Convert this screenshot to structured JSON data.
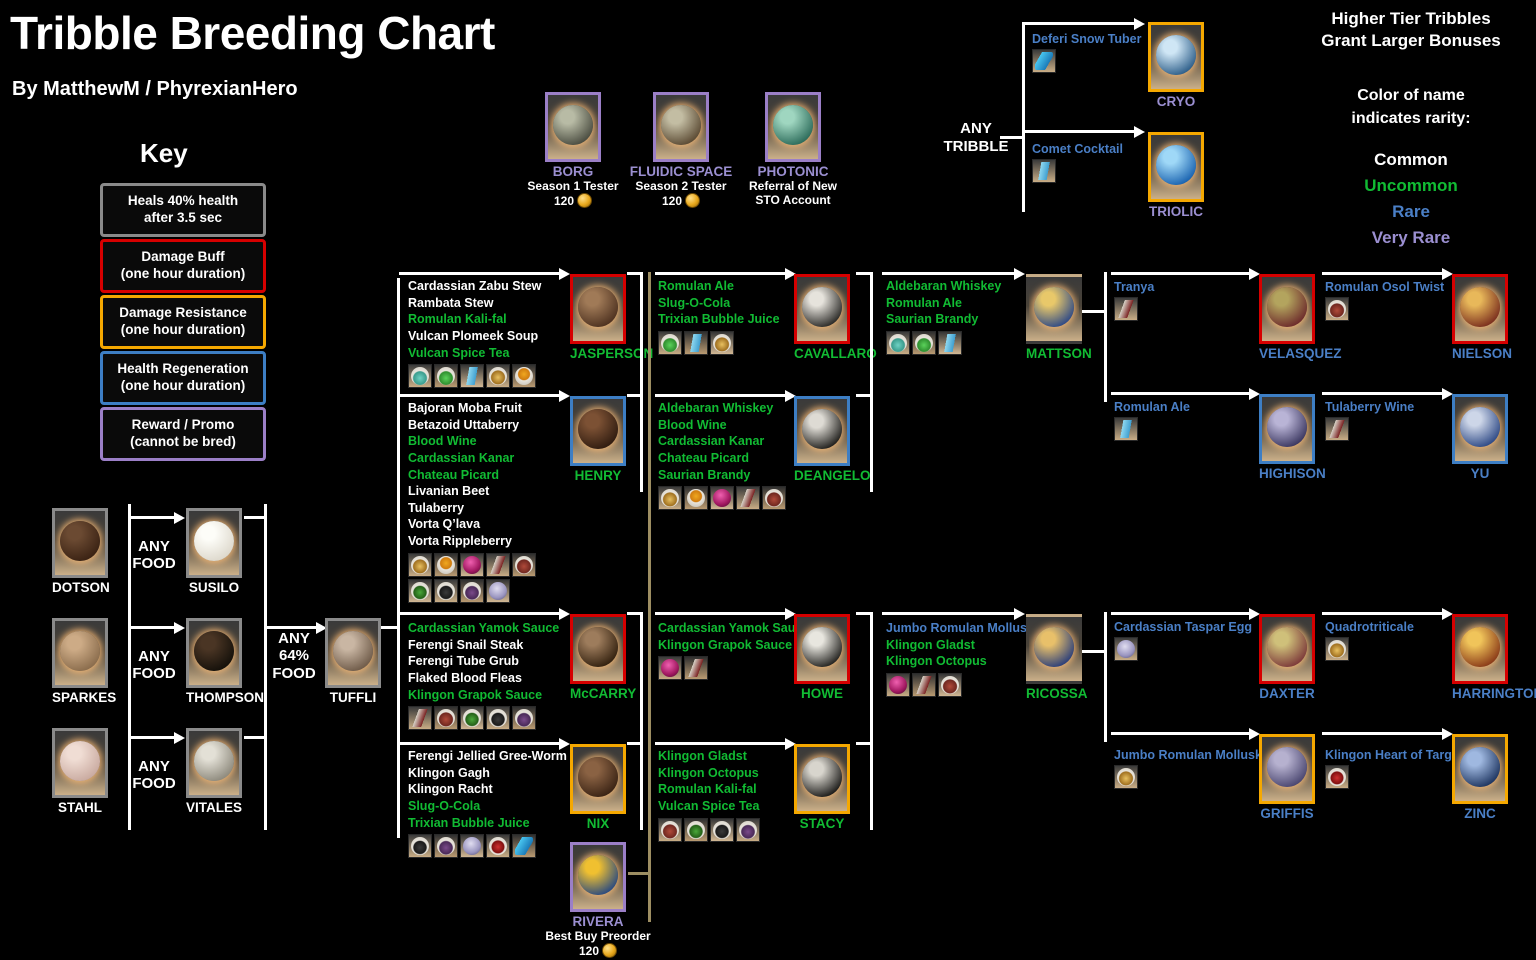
{
  "header": {
    "title": "Tribble Breeding Chart",
    "byline": "By MatthewM / PhyrexianHero",
    "key_title": "Key"
  },
  "key": {
    "items": [
      {
        "text": "Heals 40% health\nafter 3.5 sec",
        "color": "#8a8a8a",
        "name": "heal"
      },
      {
        "text": "Damage Buff\n(one hour duration)",
        "color": "#d60000",
        "name": "damage-buff"
      },
      {
        "text": "Damage Resistance\n(one hour duration)",
        "color": "#f5a800",
        "name": "damage-resistance"
      },
      {
        "text": "Health Regeneration\n(one hour duration)",
        "color": "#3d7ec4",
        "name": "health-regen"
      },
      {
        "text": "Reward / Promo\n(cannot be bred)",
        "color": "#9b7fc7",
        "name": "reward-promo"
      }
    ]
  },
  "notes": {
    "higher_tier": "Higher Tier Tribbles\nGrant Larger Bonuses",
    "color_rarity": "Color of name\nindicates rarity:",
    "rarities": [
      {
        "label": "Common",
        "color": "#ffffff"
      },
      {
        "label": "Uncommon",
        "color": "#11bb33"
      },
      {
        "label": "Rare",
        "color": "#4a7fc6"
      },
      {
        "label": "Very Rare",
        "color": "#9b8fd1"
      }
    ]
  },
  "promos": {
    "items": [
      {
        "name": "BORG",
        "sub": "Season 1 Tester",
        "cost": "120",
        "rarity": "vrare",
        "border": "purple"
      },
      {
        "name": "FLUIDIC SPACE",
        "sub": "Season 2 Tester",
        "cost": "120",
        "rarity": "vrare",
        "border": "purple"
      },
      {
        "name": "PHOTONIC",
        "sub": "Referral of New\nSTO Account",
        "cost": "",
        "rarity": "vrare",
        "border": "purple"
      }
    ]
  },
  "any_tribble": {
    "label": "ANY\nTRIBBLE",
    "branches": [
      {
        "food": "Deferi Snow Tuber",
        "food_rarity": "vrare",
        "result": "CRYO",
        "rarity": "vrare",
        "border": "orange"
      },
      {
        "food": "Comet Cocktail",
        "food_rarity": "vrare",
        "result": "TRIOLIC",
        "rarity": "vrare",
        "border": "orange"
      }
    ]
  },
  "base": {
    "any_food_label": "ANY\nFOOD",
    "any_64_label": "ANY\n64%\nFOOD",
    "pairs": [
      {
        "from": "DOTSON",
        "to": "SUSILO"
      },
      {
        "from": "SPARKES",
        "to": "THOMPSON"
      },
      {
        "from": "STAHL",
        "to": "VITALES"
      }
    ],
    "tuffli": "TUFFLI"
  },
  "stage2": [
    {
      "result": "JASPERSON",
      "rarity": "uncommon",
      "border": "red",
      "foods": [
        {
          "label": "Cardassian Zabu  Stew",
          "rarity": "common"
        },
        {
          "label": "Rambata Stew",
          "rarity": "common"
        },
        {
          "label": "Romulan Kali-fal",
          "rarity": "uncommon"
        },
        {
          "label": "Vulcan Plomeek Soup",
          "rarity": "common"
        },
        {
          "label": "Vulcan Spice Tea",
          "rarity": "uncommon"
        }
      ]
    },
    {
      "result": "HENRY",
      "rarity": "uncommon",
      "border": "blue",
      "foods": [
        {
          "label": "Bajoran Moba Fruit",
          "rarity": "common"
        },
        {
          "label": "Betazoid Uttaberry",
          "rarity": "common"
        },
        {
          "label": "Blood Wine",
          "rarity": "uncommon"
        },
        {
          "label": "Cardassian Kanar",
          "rarity": "uncommon"
        },
        {
          "label": "Chateau Picard",
          "rarity": "uncommon"
        },
        {
          "label": "Livanian Beet",
          "rarity": "common"
        },
        {
          "label": "Tulaberry",
          "rarity": "common"
        },
        {
          "label": "Vorta Q’lava",
          "rarity": "common"
        },
        {
          "label": "Vorta Rippleberry",
          "rarity": "common"
        }
      ]
    },
    {
      "result": "McCARRY",
      "rarity": "uncommon",
      "border": "red",
      "foods": [
        {
          "label": "Cardassian Yamok Sauce",
          "rarity": "uncommon"
        },
        {
          "label": "Ferengi Snail  Steak",
          "rarity": "common"
        },
        {
          "label": "Ferengi Tube Grub",
          "rarity": "common"
        },
        {
          "label": "Flaked Blood Fleas",
          "rarity": "common"
        },
        {
          "label": "Klingon Grapok Sauce",
          "rarity": "uncommon"
        }
      ]
    },
    {
      "result": "NIX",
      "rarity": "uncommon",
      "border": "orange",
      "foods": [
        {
          "label": "Ferengi Jellied Gree-Worm",
          "rarity": "common"
        },
        {
          "label": "Klingon Gagh",
          "rarity": "common"
        },
        {
          "label": "Klingon Racht",
          "rarity": "common"
        },
        {
          "label": "Slug-O-Cola",
          "rarity": "uncommon"
        },
        {
          "label": "Trixian Bubble Juice",
          "rarity": "uncommon"
        }
      ]
    }
  ],
  "rivera": {
    "name": "RIVERA",
    "sub": "Best Buy Preorder",
    "cost": "120",
    "rarity": "vrare",
    "border": "purple"
  },
  "stage3": [
    {
      "result": "CAVALLARO",
      "rarity": "uncommon",
      "border": "red",
      "foods": [
        {
          "label": "Romulan Ale",
          "rarity": "uncommon"
        },
        {
          "label": "Slug-O-Cola",
          "rarity": "uncommon"
        },
        {
          "label": "Trixian Bubble Juice",
          "rarity": "uncommon"
        }
      ]
    },
    {
      "result": "DEANGELO",
      "rarity": "uncommon",
      "border": "blue",
      "foods": [
        {
          "label": "Aldebaran Whiskey",
          "rarity": "uncommon"
        },
        {
          "label": "Blood Wine",
          "rarity": "uncommon"
        },
        {
          "label": "Cardassian Kanar",
          "rarity": "uncommon"
        },
        {
          "label": "Chateau Picard",
          "rarity": "uncommon"
        },
        {
          "label": "Saurian Brandy",
          "rarity": "uncommon"
        }
      ]
    },
    {
      "result": "HOWE",
      "rarity": "uncommon",
      "border": "red",
      "foods": [
        {
          "label": "Cardassian Yamok Sauce",
          "rarity": "uncommon"
        },
        {
          "label": "Klingon Grapok Sauce",
          "rarity": "uncommon"
        }
      ]
    },
    {
      "result": "STACY",
      "rarity": "uncommon",
      "border": "orange",
      "foods": [
        {
          "label": "Klingon Gladst",
          "rarity": "uncommon"
        },
        {
          "label": "Klingon Octopus",
          "rarity": "uncommon"
        },
        {
          "label": "Romulan Kali-fal",
          "rarity": "uncommon"
        },
        {
          "label": "Vulcan Spice Tea",
          "rarity": "uncommon"
        }
      ]
    }
  ],
  "stage4": [
    {
      "result": "MATTSON",
      "rarity": "uncommon",
      "border": "grad-br",
      "foods": [
        {
          "label": "Aldebaran Whiskey",
          "rarity": "uncommon"
        },
        {
          "label": "Romulan Ale",
          "rarity": "uncommon"
        },
        {
          "label": "Saurian Brandy",
          "rarity": "uncommon"
        }
      ]
    },
    {
      "result": "RICOSSA",
      "rarity": "uncommon",
      "border": "grad-or",
      "foods": [
        {
          "label": "Jumbo Romulan Mollusk",
          "rarity": "rare"
        },
        {
          "label": "Klingon Gladst",
          "rarity": "uncommon"
        },
        {
          "label": "Klingon Octopus",
          "rarity": "uncommon"
        }
      ]
    }
  ],
  "stage5": [
    {
      "food": "Tranya",
      "food_rarity": "rare",
      "result": "VELASQUEZ",
      "rarity": "rare",
      "border": "red"
    },
    {
      "food": "Romulan Ale",
      "food_rarity": "rare",
      "result": "HIGHISON",
      "rarity": "rare",
      "border": "blue"
    },
    {
      "food": "Cardassian Taspar  Egg",
      "food_rarity": "rare",
      "result": "DAXTER",
      "rarity": "rare",
      "border": "red"
    },
    {
      "food": "Jumbo Romulan Mollusk",
      "food_rarity": "rare",
      "result": "GRIFFIS",
      "rarity": "rare",
      "border": "orange"
    }
  ],
  "stage6": [
    {
      "food": "Romulan Osol Twist",
      "food_rarity": "rare",
      "result": "NIELSON",
      "rarity": "rare",
      "border": "red"
    },
    {
      "food": "Tulaberry Wine",
      "food_rarity": "rare",
      "result": "YU",
      "rarity": "rare",
      "border": "blue"
    },
    {
      "food": "Quadrotriticale",
      "food_rarity": "rare",
      "result": "HARRINGTON",
      "rarity": "rare",
      "border": "red"
    },
    {
      "food": "Klingon Heart of Targ",
      "food_rarity": "rare",
      "result": "ZINC",
      "rarity": "rare",
      "border": "orange"
    }
  ]
}
